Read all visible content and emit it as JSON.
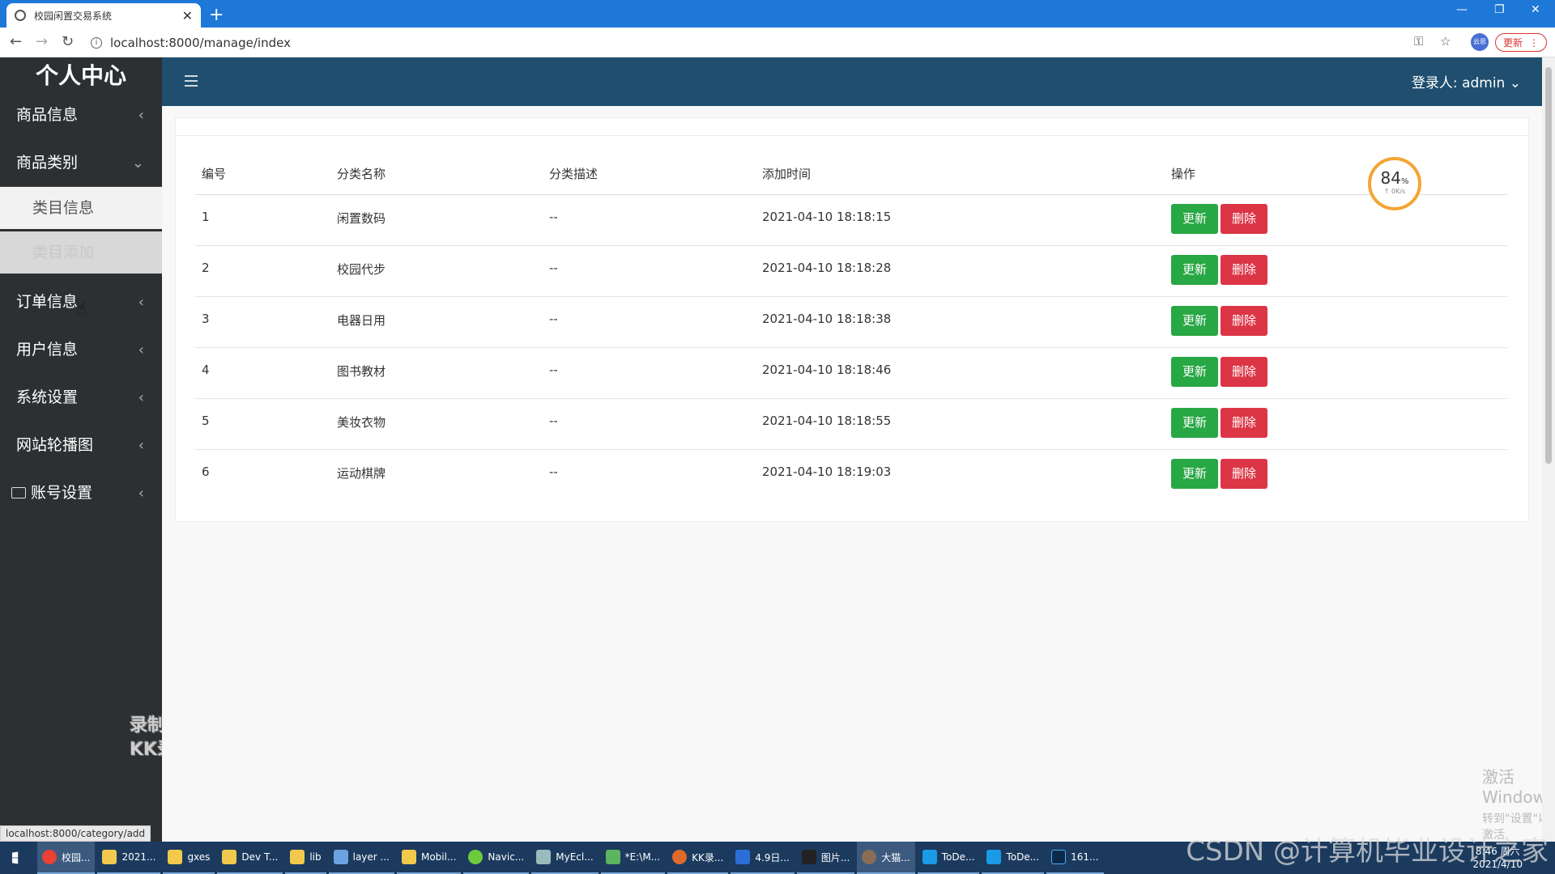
{
  "browser": {
    "tab_title": "校园闲置交易系统",
    "url": "localhost:8000/manage/index",
    "update_label": "更新",
    "profile_label": "云思"
  },
  "sidebar": {
    "title": "个人中心",
    "items": [
      {
        "label": "商品信息"
      },
      {
        "label": "商品类别"
      },
      {
        "label": "订单信息"
      },
      {
        "label": "用户信息"
      },
      {
        "label": "系统设置"
      },
      {
        "label": "网站轮播图"
      },
      {
        "label": "账号设置"
      }
    ],
    "sub_items": [
      {
        "label": "类目信息"
      },
      {
        "label": "类目添加"
      }
    ]
  },
  "topbar": {
    "login_label": "登录人: admin"
  },
  "table": {
    "headers": [
      "编号",
      "分类名称",
      "分类描述",
      "添加时间",
      "操作"
    ],
    "rows": [
      [
        "1",
        "闲置数码",
        "--",
        "2021-04-10 18:18:15"
      ],
      [
        "2",
        "校园代步",
        "--",
        "2021-04-10 18:18:28"
      ],
      [
        "3",
        "电器日用",
        "--",
        "2021-04-10 18:18:38"
      ],
      [
        "4",
        "图书教材",
        "--",
        "2021-04-10 18:18:46"
      ],
      [
        "5",
        "美妆衣物",
        "--",
        "2021-04-10 18:18:55"
      ],
      [
        "6",
        "运动棋牌",
        "--",
        "2021-04-10 18:19:03"
      ]
    ],
    "update_label": "更新",
    "delete_label": "删除"
  },
  "speed_widget": {
    "percent": "84",
    "unit": "%",
    "rate": "↑ 0K/s"
  },
  "status_url": "localhost:8000/category/add",
  "watermarks": {
    "recorder_line1": "录制工具",
    "recorder_line2": "KK录像机",
    "win_line1": "激活 Windows",
    "win_line2": "转到\"设置\"以激活 Windows。",
    "csdn": "CSDN @计算机毕业设计之家"
  },
  "taskbar": {
    "items": [
      "校园...",
      "2021...",
      "gxes",
      "Dev T...",
      "lib",
      "layer ...",
      "Mobil...",
      "Navic...",
      "MyEcl...",
      "*E:\\M...",
      "KK录...",
      "4.9日...",
      "图片...",
      "大猫...",
      "ToDe...",
      "ToDe...",
      "161..."
    ],
    "time": "8:46 周六",
    "date": "2021/4/10"
  },
  "colors": {
    "sidebar_bg": "#2c3032",
    "topbar_bg": "#1f4e6f",
    "update_btn": "#28a745",
    "delete_btn": "#dc3545"
  }
}
